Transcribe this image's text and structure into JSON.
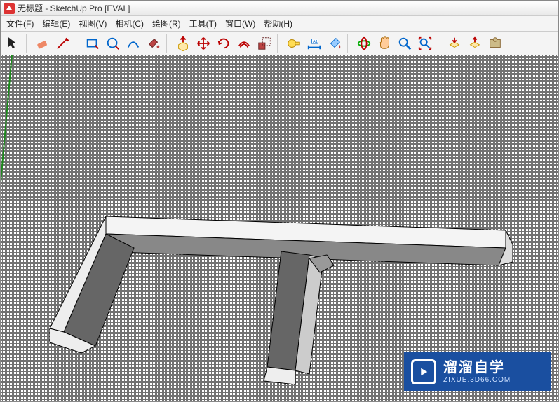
{
  "title": "无标题 - SketchUp Pro [EVAL]",
  "menu": {
    "file": "文件(F)",
    "edit": "编辑(E)",
    "view": "视图(V)",
    "camera": "相机(C)",
    "draw": "绘图(R)",
    "tools": "工具(T)",
    "window": "窗口(W)",
    "help": "帮助(H)"
  },
  "toolbar_icons": [
    "select",
    "eraser",
    "pencil",
    "eraser2",
    "rectangle",
    "circle",
    "paint",
    "pushpull",
    "offset",
    "move",
    "rotate",
    "scale",
    "tape",
    "dimension",
    "text",
    "orbit",
    "pan",
    "zoom",
    "zoom-extents",
    "prev-view",
    "shadow",
    "help"
  ],
  "watermark": {
    "big": "溜溜自学",
    "small": "ZIXUE.3D66.COM"
  }
}
